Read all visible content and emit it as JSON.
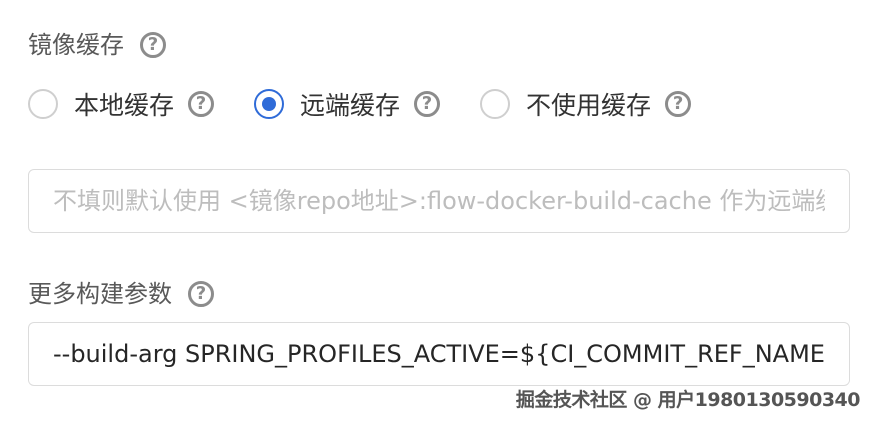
{
  "image_cache": {
    "label": "镜像缓存",
    "help_glyph": "?",
    "options": [
      {
        "label": "本地缓存",
        "checked": false
      },
      {
        "label": "远端缓存",
        "checked": true
      },
      {
        "label": "不使用缓存",
        "checked": false
      }
    ],
    "input": {
      "value": "",
      "placeholder": "不填则默认使用 <镜像repo地址>:flow-docker-build-cache 作为远端缓存"
    }
  },
  "build_args": {
    "label": "更多构建参数",
    "help_glyph": "?",
    "input": {
      "value": "--build-arg SPRING_PROFILES_ACTIVE=${CI_COMMIT_REF_NAME}",
      "placeholder": ""
    }
  },
  "watermark": "掘金技术社区 @ 用户1980130590340",
  "colors": {
    "accent": "#2f6bd8",
    "label_text": "#595959",
    "icon_gray": "#8c8c8c",
    "border": "#dcdcdc",
    "placeholder": "#bdbdbd"
  }
}
